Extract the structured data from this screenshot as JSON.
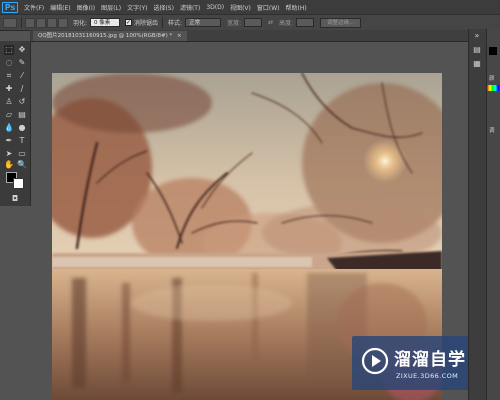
{
  "app": {
    "logo": "Ps",
    "menus": [
      "文件(F)",
      "编辑(E)",
      "图像(I)",
      "图层(L)",
      "文字(Y)",
      "选择(S)",
      "滤镜(T)",
      "3D(D)",
      "视图(V)",
      "窗口(W)",
      "帮助(H)"
    ]
  },
  "options": {
    "feather_label": "羽化:",
    "feather_value": "0 像素",
    "antialias_label": "消除锯齿",
    "antialias_checked": true,
    "style_label": "样式:",
    "style_value": "正常",
    "width_label": "宽度:",
    "height_label": "高度:",
    "refine_edge_button": "调整边缘..."
  },
  "document": {
    "tab_title": "QQ图片20181031160915.jpg @ 100%(RGB/8#) *",
    "close_glyph": "×"
  },
  "toolbox": {
    "icons": [
      "move-tool-icon",
      "marquee-tool-icon",
      "lasso-tool-icon",
      "quick-select-tool-icon",
      "crop-tool-icon",
      "eyedropper-tool-icon",
      "healing-brush-tool-icon",
      "brush-tool-icon",
      "clone-stamp-tool-icon",
      "history-brush-tool-icon",
      "eraser-tool-icon",
      "gradient-tool-icon",
      "blur-tool-icon",
      "dodge-tool-icon",
      "pen-tool-icon",
      "type-tool-icon",
      "path-select-tool-icon",
      "shape-tool-icon",
      "hand-tool-icon",
      "zoom-tool-icon"
    ],
    "foreground_color": "#000000",
    "background_color": "#ffffff"
  },
  "watermark": {
    "title": "溜溜自学",
    "url": "ZIXUE.3D66.COM"
  },
  "right_panel": {
    "labels": [
      "颜",
      "调"
    ]
  }
}
